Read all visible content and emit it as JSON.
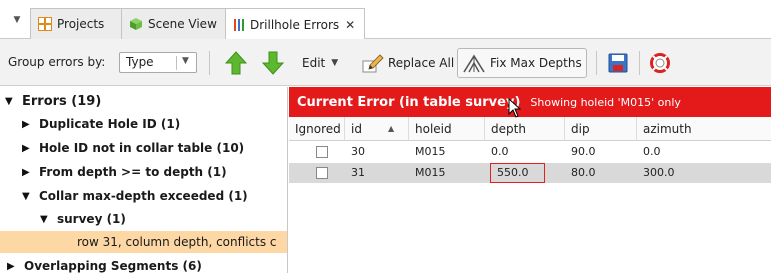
{
  "tabs": [
    {
      "label": "Projects",
      "icon": "projects-icon"
    },
    {
      "label": "Scene View",
      "icon": "scene-cube-icon"
    },
    {
      "label": "Drillhole Errors",
      "icon": "drillhole-icon",
      "close": "✕"
    }
  ],
  "toolbar": {
    "group_label": "Group errors by:",
    "group_value": "Type",
    "edit_label": "Edit",
    "replace_all_label": "Replace All",
    "fix_max_depths_label": "Fix Max Depths"
  },
  "tree": {
    "root": "Errors (19)",
    "items": [
      "Duplicate Hole ID (1)",
      "Hole ID not in collar table (10)",
      "From depth >= to depth (1)",
      "Collar max-depth exceeded (1)",
      "survey (1)",
      "row 31, column depth, conflicts c",
      "Overlapping Segments (6)"
    ]
  },
  "banner": {
    "title": "Current Error (in table survey)",
    "subtitle": "Showing holeid 'M015' only"
  },
  "table": {
    "columns": [
      "Ignored",
      "id",
      "holeid",
      "depth",
      "dip",
      "azimuth"
    ],
    "rows": [
      {
        "id": "30",
        "holeid": "M015",
        "depth": "0.0",
        "dip": "90.0",
        "azimuth": "0.0"
      },
      {
        "id": "31",
        "holeid": "M015",
        "depth": "550.0",
        "dip": "80.0",
        "azimuth": "300.0"
      }
    ]
  },
  "colors": {
    "error_banner": "#e41a1a",
    "selected_tree_item": "#fdd7a4",
    "arrow_green": "#5cb82e"
  }
}
